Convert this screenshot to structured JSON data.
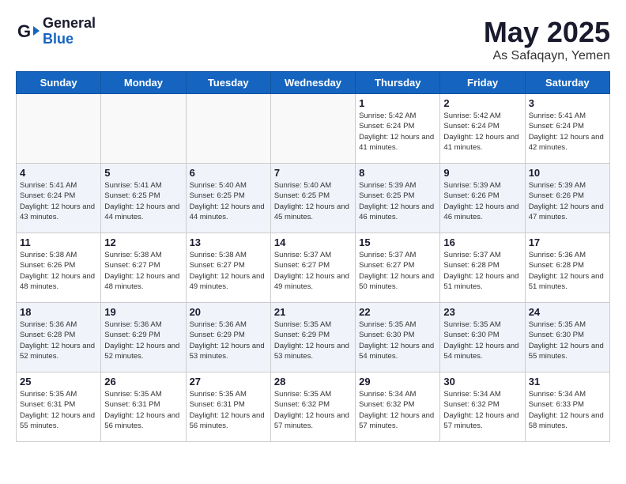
{
  "header": {
    "logo_general": "General",
    "logo_blue": "Blue",
    "title": "May 2025",
    "location": "As Safaqayn, Yemen"
  },
  "days_of_week": [
    "Sunday",
    "Monday",
    "Tuesday",
    "Wednesday",
    "Thursday",
    "Friday",
    "Saturday"
  ],
  "weeks": [
    {
      "days": [
        {
          "num": "",
          "empty": true
        },
        {
          "num": "",
          "empty": true
        },
        {
          "num": "",
          "empty": true
        },
        {
          "num": "",
          "empty": true
        },
        {
          "num": "1",
          "sunrise": "5:42 AM",
          "sunset": "6:24 PM",
          "daylight": "12 hours and 41 minutes."
        },
        {
          "num": "2",
          "sunrise": "5:42 AM",
          "sunset": "6:24 PM",
          "daylight": "12 hours and 41 minutes."
        },
        {
          "num": "3",
          "sunrise": "5:41 AM",
          "sunset": "6:24 PM",
          "daylight": "12 hours and 42 minutes."
        }
      ]
    },
    {
      "days": [
        {
          "num": "4",
          "sunrise": "5:41 AM",
          "sunset": "6:24 PM",
          "daylight": "12 hours and 43 minutes."
        },
        {
          "num": "5",
          "sunrise": "5:41 AM",
          "sunset": "6:25 PM",
          "daylight": "12 hours and 44 minutes."
        },
        {
          "num": "6",
          "sunrise": "5:40 AM",
          "sunset": "6:25 PM",
          "daylight": "12 hours and 44 minutes."
        },
        {
          "num": "7",
          "sunrise": "5:40 AM",
          "sunset": "6:25 PM",
          "daylight": "12 hours and 45 minutes."
        },
        {
          "num": "8",
          "sunrise": "5:39 AM",
          "sunset": "6:25 PM",
          "daylight": "12 hours and 46 minutes."
        },
        {
          "num": "9",
          "sunrise": "5:39 AM",
          "sunset": "6:26 PM",
          "daylight": "12 hours and 46 minutes."
        },
        {
          "num": "10",
          "sunrise": "5:39 AM",
          "sunset": "6:26 PM",
          "daylight": "12 hours and 47 minutes."
        }
      ]
    },
    {
      "days": [
        {
          "num": "11",
          "sunrise": "5:38 AM",
          "sunset": "6:26 PM",
          "daylight": "12 hours and 48 minutes."
        },
        {
          "num": "12",
          "sunrise": "5:38 AM",
          "sunset": "6:27 PM",
          "daylight": "12 hours and 48 minutes."
        },
        {
          "num": "13",
          "sunrise": "5:38 AM",
          "sunset": "6:27 PM",
          "daylight": "12 hours and 49 minutes."
        },
        {
          "num": "14",
          "sunrise": "5:37 AM",
          "sunset": "6:27 PM",
          "daylight": "12 hours and 49 minutes."
        },
        {
          "num": "15",
          "sunrise": "5:37 AM",
          "sunset": "6:27 PM",
          "daylight": "12 hours and 50 minutes."
        },
        {
          "num": "16",
          "sunrise": "5:37 AM",
          "sunset": "6:28 PM",
          "daylight": "12 hours and 51 minutes."
        },
        {
          "num": "17",
          "sunrise": "5:36 AM",
          "sunset": "6:28 PM",
          "daylight": "12 hours and 51 minutes."
        }
      ]
    },
    {
      "days": [
        {
          "num": "18",
          "sunrise": "5:36 AM",
          "sunset": "6:28 PM",
          "daylight": "12 hours and 52 minutes."
        },
        {
          "num": "19",
          "sunrise": "5:36 AM",
          "sunset": "6:29 PM",
          "daylight": "12 hours and 52 minutes."
        },
        {
          "num": "20",
          "sunrise": "5:36 AM",
          "sunset": "6:29 PM",
          "daylight": "12 hours and 53 minutes."
        },
        {
          "num": "21",
          "sunrise": "5:35 AM",
          "sunset": "6:29 PM",
          "daylight": "12 hours and 53 minutes."
        },
        {
          "num": "22",
          "sunrise": "5:35 AM",
          "sunset": "6:30 PM",
          "daylight": "12 hours and 54 minutes."
        },
        {
          "num": "23",
          "sunrise": "5:35 AM",
          "sunset": "6:30 PM",
          "daylight": "12 hours and 54 minutes."
        },
        {
          "num": "24",
          "sunrise": "5:35 AM",
          "sunset": "6:30 PM",
          "daylight": "12 hours and 55 minutes."
        }
      ]
    },
    {
      "days": [
        {
          "num": "25",
          "sunrise": "5:35 AM",
          "sunset": "6:31 PM",
          "daylight": "12 hours and 55 minutes."
        },
        {
          "num": "26",
          "sunrise": "5:35 AM",
          "sunset": "6:31 PM",
          "daylight": "12 hours and 56 minutes."
        },
        {
          "num": "27",
          "sunrise": "5:35 AM",
          "sunset": "6:31 PM",
          "daylight": "12 hours and 56 minutes."
        },
        {
          "num": "28",
          "sunrise": "5:35 AM",
          "sunset": "6:32 PM",
          "daylight": "12 hours and 57 minutes."
        },
        {
          "num": "29",
          "sunrise": "5:34 AM",
          "sunset": "6:32 PM",
          "daylight": "12 hours and 57 minutes."
        },
        {
          "num": "30",
          "sunrise": "5:34 AM",
          "sunset": "6:32 PM",
          "daylight": "12 hours and 57 minutes."
        },
        {
          "num": "31",
          "sunrise": "5:34 AM",
          "sunset": "6:33 PM",
          "daylight": "12 hours and 58 minutes."
        }
      ]
    }
  ]
}
